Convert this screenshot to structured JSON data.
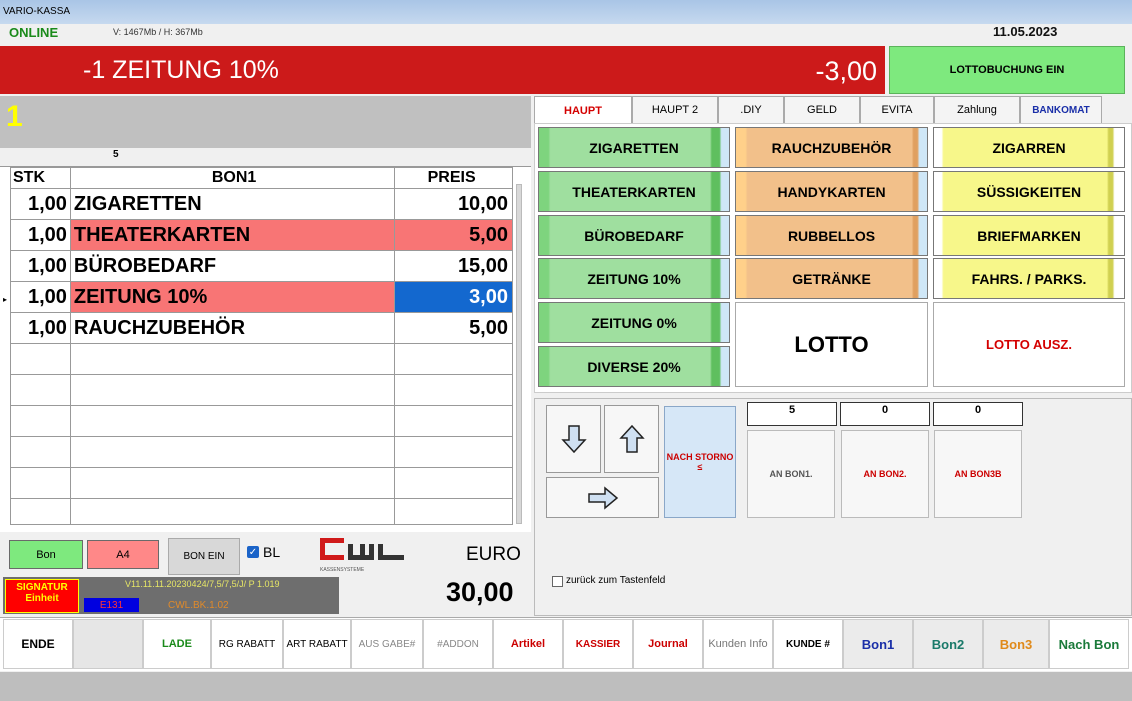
{
  "window": {
    "title": "VARIO-KASSA"
  },
  "top": {
    "status": "ONLINE",
    "memory": "V: 1467Mb / H: 367Mb",
    "date": "11.05.2023"
  },
  "banner": {
    "label": "-1 ZEITUNG 10%",
    "value": "-3,00",
    "lotto_button": "LOTTOBUCHUNG EIN"
  },
  "receipt": {
    "bon_number": "1",
    "item_count": "5",
    "headers": {
      "qty": "STK",
      "name": "BON1",
      "price": "PREIS"
    },
    "rows": [
      {
        "qty": "1,00",
        "name": "ZIGARETTEN",
        "price": "10,00"
      },
      {
        "qty": "1,00",
        "name": "THEATERKARTEN",
        "price": "5,00"
      },
      {
        "qty": "1,00",
        "name": "BÜROBEDARF",
        "price": "15,00"
      },
      {
        "qty": "1,00",
        "name": "ZEITUNG 10%",
        "price": "3,00"
      },
      {
        "qty": "1,00",
        "name": "RAUCHZUBEHÖR",
        "price": "5,00"
      }
    ],
    "row_marker": "▸"
  },
  "bottom_left": {
    "bon": "Bon",
    "a4": "A4",
    "bon_ein": "BON EIN",
    "bl_label": "BL",
    "bl_check": "✓",
    "currency": "EURO",
    "total": "30,00",
    "signatur": "SIGNATUR Einheit",
    "version": "V11.11.11.20230424/7,5/7,5/J/ P 1.019",
    "error": "E131",
    "bk": "CWL.BK.1.02",
    "logo_text": "CWL",
    "logo_sub": "KASSENSYSTEME"
  },
  "tabs": [
    "HAUPT",
    "HAUPT 2",
    ".DIY",
    "GELD",
    "EVITA",
    "Zahlung",
    "BANKOMAT"
  ],
  "categories": {
    "col1": [
      "ZIGARETTEN",
      "THEATERKARTEN",
      "BÜROBEDARF",
      "ZEITUNG 10%",
      "ZEITUNG  0%",
      "DIVERSE 20%"
    ],
    "col2": [
      "RAUCHZUBEHÖR",
      "HANDYKARTEN",
      "RUBBELLOS",
      "GETRÄNKE"
    ],
    "col3": [
      "ZIGARREN",
      "SÜSSIGKEITEN",
      "BRIEFMARKEN",
      "FAHRS. / PARKS."
    ],
    "lotto": "LOTTO",
    "lotto_ausz": "LOTTO AUSZ."
  },
  "nav": {
    "nach_storno": "NACH STORNO ≤"
  },
  "counts": [
    "5",
    "0",
    "0"
  ],
  "an_bon": [
    "AN BON1.",
    "AN BON2.",
    "AN BON3B"
  ],
  "zurueck": "zurück zum Tastenfeld",
  "bottom_bar": [
    "ENDE",
    "LADE",
    "RG RABATT",
    "ART RABATT",
    "AUS GABE#",
    "#ADDON",
    "Artikel",
    "KASSIER",
    "Journal",
    "Kunden Info",
    "KUNDE #",
    "Bon1",
    "Bon2",
    "Bon3",
    "Nach Bon"
  ],
  "colors": {
    "red": "#cc1a1a",
    "green": "#7ee97e",
    "selection": "#1368cf"
  }
}
